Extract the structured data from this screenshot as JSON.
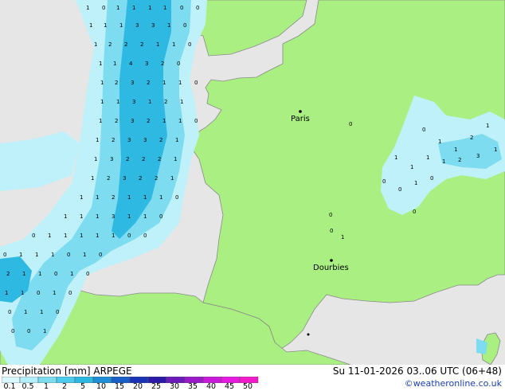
{
  "map": {
    "cities": [
      {
        "name": "Paris"
      },
      {
        "name": "Dourbies"
      }
    ],
    "colors": {
      "land": "#aaef81",
      "sea": "#e6e6e6",
      "precip_light": "#bff1fa",
      "precip_mid": "#7ddcf0",
      "precip_heavy": "#2eb9e3"
    }
  },
  "footer": {
    "title": "Precipitation [mm]  ARPEGE",
    "datetime": "Su 11-01-2026 03..06 UTC (06+48)",
    "credit": "©weatheronline.co.uk",
    "scale_labels": [
      "0.1",
      "0.5",
      "1",
      "2",
      "5",
      "10",
      "15",
      "20",
      "25",
      "30",
      "35",
      "40",
      "45",
      "50"
    ],
    "scale_colors": [
      "#d9f7fd",
      "#b3eefb",
      "#7ddcf0",
      "#4ccbec",
      "#2eb9e3",
      "#1e8fd6",
      "#1a5fc8",
      "#1a34b8",
      "#2a1aa8",
      "#6a1ab8",
      "#9a1ac8",
      "#c81ad8",
      "#e81ae0",
      "#f21acb"
    ]
  }
}
